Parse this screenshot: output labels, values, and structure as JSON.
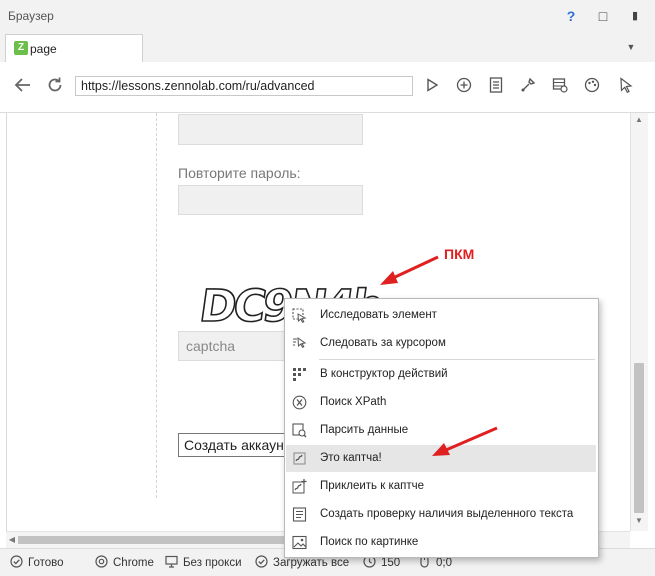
{
  "window": {
    "title": "Браузер",
    "help": "?",
    "restore": "□",
    "pin": "▮"
  },
  "tab": {
    "logo": "Z",
    "label": "page",
    "menu_glyph": "▼"
  },
  "toolbar": {
    "url": "https://lessons.zennolab.com/ru/advanced"
  },
  "page": {
    "repeat_password_label": "Повторите пароль:",
    "captcha_text": "DC9N4b",
    "captcha_placeholder": "captcha",
    "create_button": "Создать аккаунт"
  },
  "context_menu": {
    "items": [
      {
        "label": "Исследовать элемент",
        "icon": "inspect-icon"
      },
      {
        "label": "Следовать за курсором",
        "icon": "follow-cursor-icon"
      },
      {
        "label": "В конструктор действий",
        "icon": "action-builder-icon"
      },
      {
        "label": "Поиск XPath",
        "icon": "xpath-icon"
      },
      {
        "label": "Парсить данные",
        "icon": "parse-icon"
      },
      {
        "label": "Это каптча!",
        "icon": "captcha-icon"
      },
      {
        "label": "Приклеить к каптче",
        "icon": "attach-captcha-icon"
      },
      {
        "label": "Создать проверку наличия выделенного текста",
        "icon": "text-check-icon"
      },
      {
        "label": "Поиск по картинке",
        "icon": "image-search-icon"
      }
    ]
  },
  "annotation": {
    "label": "ПКМ",
    "color": "#e02020"
  },
  "statusbar": {
    "ready": "Готово",
    "browser": "Chrome",
    "proxy": "Без прокси",
    "load": "Загружать все",
    "timer": "150",
    "coords": "0;0"
  }
}
